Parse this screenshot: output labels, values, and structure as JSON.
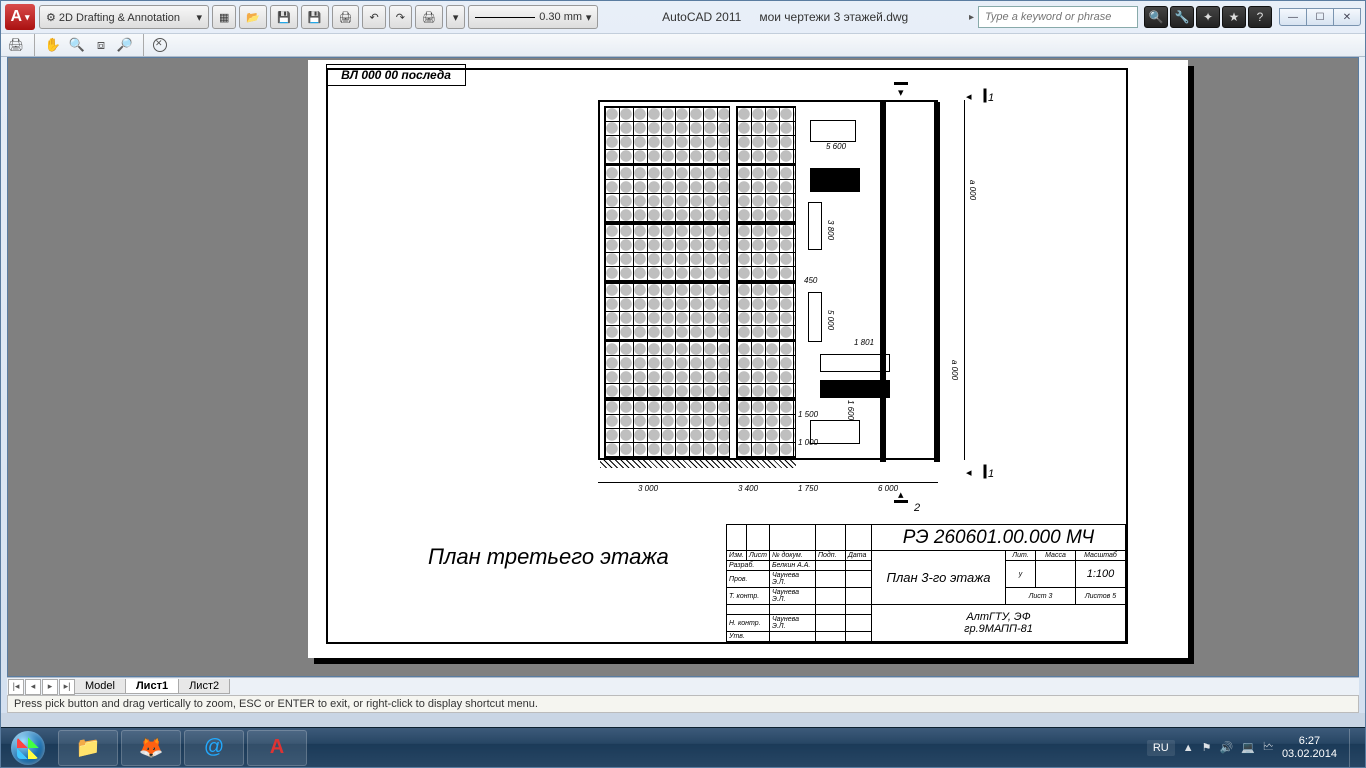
{
  "app": {
    "name": "AutoCAD 2011",
    "document": "мои чертежи 3 этажей.dwg",
    "workspace": "2D Drafting & Annotation",
    "lineweight": "0.30 mm",
    "search_placeholder": "Type a keyword or phrase"
  },
  "tabs": {
    "t0": "Model",
    "t1": "Лист1",
    "t2": "Лист2"
  },
  "command_prompt": "Press pick button and drag vertically to zoom, ESC or ENTER to exit, or right-click to display shortcut menu.",
  "drawing": {
    "top_note": "ВЛ 000 00 последа",
    "caption": "План третьего этажа",
    "section_1": "1",
    "section_2": "2",
    "dims": {
      "bottom_a": "3 000",
      "bottom_b": "3 400",
      "bottom_c": "1 750",
      "bottom_d": "6 000",
      "right_total": "a 000",
      "right_mid": "a 000",
      "int_1500": "1 500",
      "int_1000": "1 000",
      "int_1600": "1 600",
      "int_3800": "3 800",
      "int_5000": "5 000",
      "int_5600": "5 600",
      "int_450": "450",
      "int_1801": "1 801"
    }
  },
  "titleblock": {
    "code": "РЭ  260601.00.000 МЧ",
    "plan_title": "План 3-го этажа",
    "lit_h": "Лит.",
    "mass_h": "Масса",
    "scale_h": "Масштаб",
    "lit_v": "у",
    "scale": "1:100",
    "sheet": "Лист 3",
    "sheets": "Листов 5",
    "org1": "АлтГТУ, ЭФ",
    "org2": "гр.9МАПП-81",
    "rows_h": {
      "izm": "Изм.",
      "list": "Лист",
      "ndoc": "№ докум.",
      "podp": "Подп.",
      "data": "Дата"
    },
    "rows": {
      "razrab": "Разраб.",
      "razrab_n": "Белкин А.А.",
      "prov": "Пров.",
      "prov_n": "Чаунева Э.Л.",
      "tkontr": "Т. контр.",
      "tkontr_n": "Чаунева Э.Л.",
      "nkontr": "Н. контр.",
      "nkontr_n": "Чаунева Э.Л.",
      "utv": "Утв."
    }
  },
  "taskbar": {
    "lang": "RU",
    "time": "6:27",
    "date": "03.02.2014"
  }
}
